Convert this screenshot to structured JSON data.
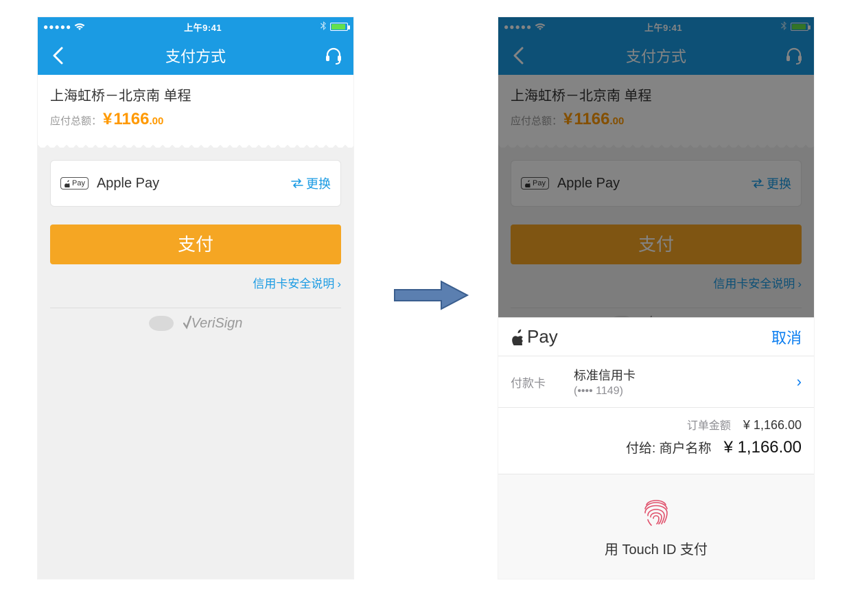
{
  "status": {
    "time": "上午9:41"
  },
  "nav": {
    "title": "支付方式"
  },
  "trip": {
    "route": "上海虹桥－北京南 单程",
    "amount_label": "应付总额：",
    "currency": "¥",
    "amount_int": "1166",
    "amount_dec": ".00"
  },
  "method": {
    "badge_text": "Pay",
    "name": "Apple Pay",
    "change_label": "更换"
  },
  "pay_button": "支付",
  "security_link": "信用卡安全说明",
  "trust_label": "VeriSign",
  "sheet": {
    "logo_text": "Pay",
    "cancel": "取消",
    "card_label": "付款卡",
    "card_name": "标准信用卡",
    "card_mask": "(•••• 1149)",
    "order_label": "订单金额",
    "order_value": "¥ 1,166.00",
    "pay_to_label": "付给:",
    "merchant": "商户名称",
    "total_value": "¥ 1,166.00",
    "touchid_label": "用 Touch ID 支付"
  }
}
